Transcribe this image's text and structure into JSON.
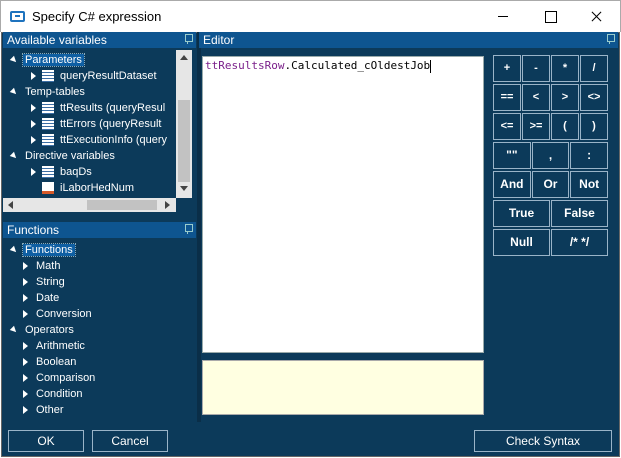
{
  "window": {
    "title": "Specify C# expression"
  },
  "colors": {
    "panel_bg": "#0c3a5a",
    "header_bg": "#0e5590",
    "selected": "#0f5fa3",
    "editor_bg": "#ffffff",
    "message_bg": "#ffffe1",
    "token": "#7a1f8a"
  },
  "variables_panel": {
    "header": "Available variables",
    "items": [
      {
        "label": "Parameters",
        "expander": "open",
        "icon": "",
        "level": 0,
        "selected": true
      },
      {
        "label": "queryResultDataset",
        "expander": "closed",
        "icon": "table-icon",
        "level": 1
      },
      {
        "label": "Temp-tables",
        "expander": "open",
        "icon": "",
        "level": 0
      },
      {
        "label": "ttResults (queryResul",
        "expander": "closed",
        "icon": "table-icon",
        "level": 1
      },
      {
        "label": "ttErrors (queryResult",
        "expander": "closed",
        "icon": "table-icon",
        "level": 1
      },
      {
        "label": "ttExecutionInfo (query",
        "expander": "closed",
        "icon": "table-icon",
        "level": 1
      },
      {
        "label": "Directive variables",
        "expander": "open",
        "icon": "",
        "level": 0
      },
      {
        "label": "baqDs",
        "expander": "closed",
        "icon": "table-icon",
        "level": 1
      },
      {
        "label": "iLaborHedNum",
        "expander": "",
        "icon": "variable-icon",
        "level": 1
      }
    ]
  },
  "functions_panel": {
    "header": "Functions",
    "items": [
      {
        "label": "Functions",
        "expander": "open",
        "level": 0,
        "selected": true
      },
      {
        "label": "Math",
        "expander": "closed",
        "level": 1
      },
      {
        "label": "String",
        "expander": "closed",
        "level": 1
      },
      {
        "label": "Date",
        "expander": "closed",
        "level": 1
      },
      {
        "label": "Conversion",
        "expander": "closed",
        "level": 1
      },
      {
        "label": "Operators",
        "expander": "open",
        "level": 0
      },
      {
        "label": "Arithmetic",
        "expander": "closed",
        "level": 1
      },
      {
        "label": "Boolean",
        "expander": "closed",
        "level": 1
      },
      {
        "label": "Comparison",
        "expander": "closed",
        "level": 1
      },
      {
        "label": "Condition",
        "expander": "closed",
        "level": 1
      },
      {
        "label": "Other",
        "expander": "closed",
        "level": 1
      }
    ]
  },
  "editor": {
    "header": "Editor",
    "token_object": "ttResultsRow",
    "token_rest": ".Calculated_cOldestJob"
  },
  "keypad": {
    "rows": [
      [
        "+",
        "-",
        "*",
        "/"
      ],
      [
        "==",
        "<",
        ">",
        "<>"
      ],
      [
        "<=",
        ">=",
        "(",
        ")"
      ],
      [
        "\"\"",
        ",",
        ":"
      ],
      [
        "And",
        "Or",
        "Not"
      ],
      [
        "True",
        "False"
      ],
      [
        "Null",
        "/* */"
      ]
    ]
  },
  "buttons": {
    "ok": "OK",
    "cancel": "Cancel",
    "check_syntax": "Check Syntax"
  }
}
